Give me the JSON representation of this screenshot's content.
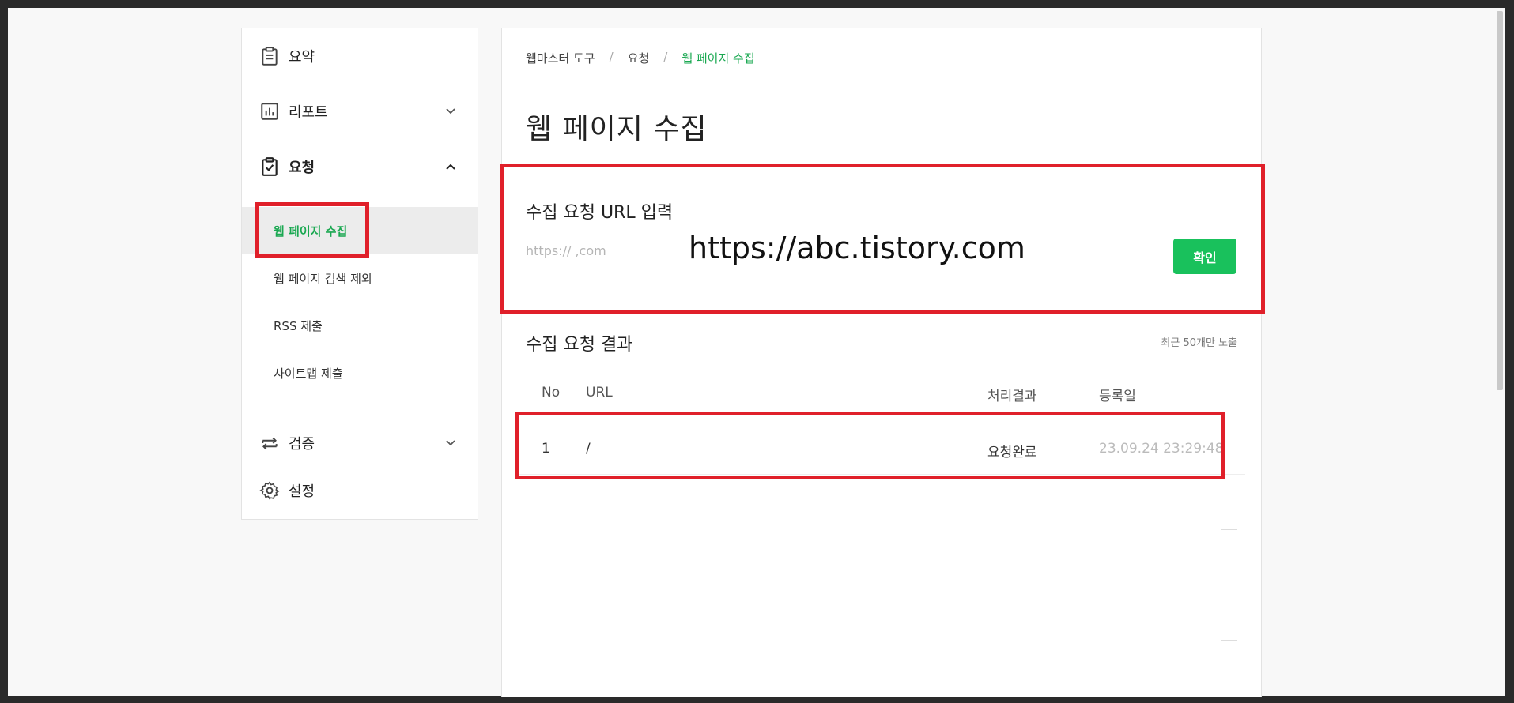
{
  "sidebar": {
    "items": [
      {
        "label": "요약",
        "icon": "clipboard-list-icon"
      },
      {
        "label": "리포트",
        "icon": "bar-chart-icon",
        "chevron": "chevron-down-icon"
      },
      {
        "label": "요청",
        "icon": "clipboard-check-icon",
        "chevron": "chevron-up-icon",
        "expanded": true
      },
      {
        "label": "검증",
        "icon": "repeat-arrows-icon",
        "chevron": "chevron-down-icon"
      },
      {
        "label": "설정",
        "icon": "gear-icon"
      }
    ],
    "subitems": [
      {
        "label": "웹 페이지 수집",
        "active": true
      },
      {
        "label": "웹 페이지 검색 제외"
      },
      {
        "label": "RSS 제출"
      },
      {
        "label": "사이트맵 제출"
      }
    ]
  },
  "breadcrumb": [
    "웹마스터 도구",
    "요청",
    "웹 페이지 수집"
  ],
  "page_title": "웹 페이지 수집",
  "url_form": {
    "label": "수집 요청 URL 입력",
    "placeholder": "https://          ,com",
    "value": "https://abc.tistory.com",
    "button": "확인"
  },
  "results": {
    "title": "수집 요청 결과",
    "note": "최근 50개만 노출",
    "columns": [
      "No",
      "URL",
      "처리결과",
      "등록일"
    ],
    "rows": [
      {
        "no": "1",
        "url": "/",
        "status": "요청완료",
        "date": "23.09.24 23:29:48"
      }
    ]
  },
  "colors": {
    "accent_green": "#1aa851",
    "button_green": "#19c15c",
    "highlight_red": "#e0202a"
  }
}
